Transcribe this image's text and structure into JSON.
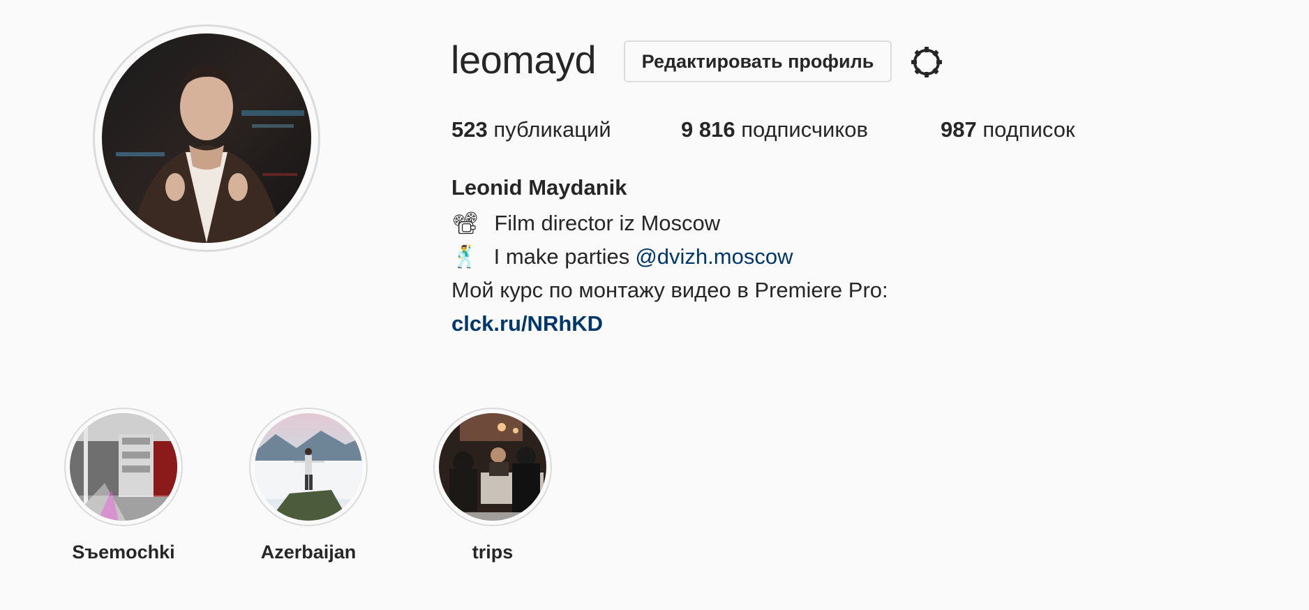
{
  "profile": {
    "username": "leomayd",
    "edit_button_label": "Редактировать профиль",
    "settings_icon": "gear-icon",
    "stats": {
      "posts_count": "523",
      "posts_label": "публикаций",
      "followers_count": "9 816",
      "followers_label": "подписчиков",
      "following_count": "987",
      "following_label": "подписок"
    },
    "bio": {
      "full_name": "Leonid Maydanik",
      "line1_emoji": "📽",
      "line1_text": "Film director iz Moscow",
      "line2_emoji": "🕺",
      "line2_text": "I make parties",
      "line2_mention": "@dvizh.moscow",
      "line3_text": "Мой курс по монтажу видео в Premiere Pro:",
      "link": "clck.ru/NRhKD"
    }
  },
  "highlights": [
    {
      "label": "Sъemochki"
    },
    {
      "label": "Azerbaijan"
    },
    {
      "label": "trips"
    }
  ],
  "colors": {
    "background": "#fafafa",
    "text": "#262626",
    "link": "#00376b",
    "border": "#dbdbdb"
  }
}
